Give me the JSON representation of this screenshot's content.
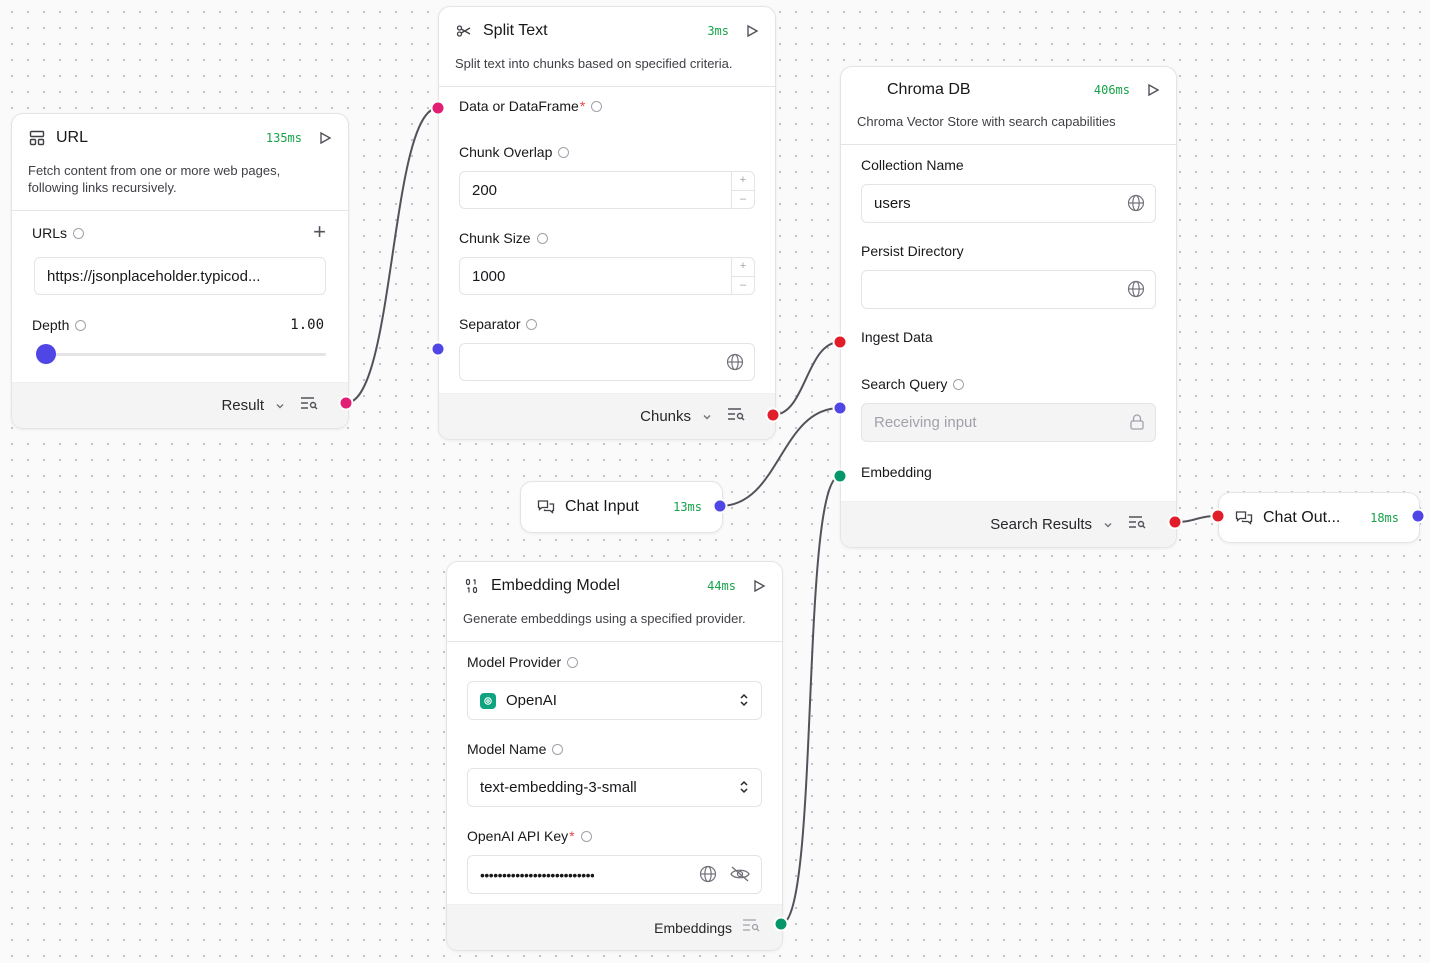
{
  "nodes": {
    "url": {
      "title": "URL",
      "timing": "135ms",
      "description_line1": "Fetch content from one or more web pages,",
      "description_line2": "following links recursively.",
      "urls_label": "URLs",
      "url_value": "https://jsonplaceholder.typicod...",
      "depth_label": "Depth",
      "depth_value": "1.00",
      "depth_fraction": 0.0,
      "output_label": "Result"
    },
    "split_text": {
      "title": "Split Text",
      "timing": "3ms",
      "description": "Split text into chunks based on specified criteria.",
      "data_label": "Data or DataFrame",
      "required_mark": "*",
      "overlap_label": "Chunk Overlap",
      "overlap_value": "200",
      "size_label": "Chunk Size",
      "size_value": "1000",
      "separator_label": "Separator",
      "separator_value": "",
      "output_label": "Chunks"
    },
    "chroma": {
      "title": "Chroma DB",
      "timing": "406ms",
      "description": "Chroma Vector Store with search capabilities",
      "collection_label": "Collection Name",
      "collection_value": "users",
      "persist_label": "Persist Directory",
      "persist_value": "",
      "ingest_label": "Ingest Data",
      "query_label": "Search Query",
      "query_placeholder": "Receiving input",
      "embedding_label": "Embedding",
      "output_label": "Search Results"
    },
    "chat_input": {
      "title": "Chat Input",
      "timing": "13ms"
    },
    "chat_output": {
      "title": "Chat Out...",
      "timing": "18ms"
    },
    "embedding": {
      "title": "Embedding Model",
      "timing": "44ms",
      "description": "Generate embeddings using a specified provider.",
      "provider_label": "Model Provider",
      "provider_value": "OpenAI",
      "model_label": "Model Name",
      "model_value": "text-embedding-3-small",
      "apikey_label": "OpenAI API Key",
      "required_mark": "*",
      "apikey_value": "••••••••••••••••••••••••••",
      "output_label": "Embeddings"
    }
  },
  "colors": {
    "timing": "#16a34a",
    "handle_pink": "#e11d74",
    "handle_blue": "#4f46e5",
    "handle_red": "#e11d2a",
    "handle_green": "#059669",
    "openai_brand": "#10a37f"
  }
}
